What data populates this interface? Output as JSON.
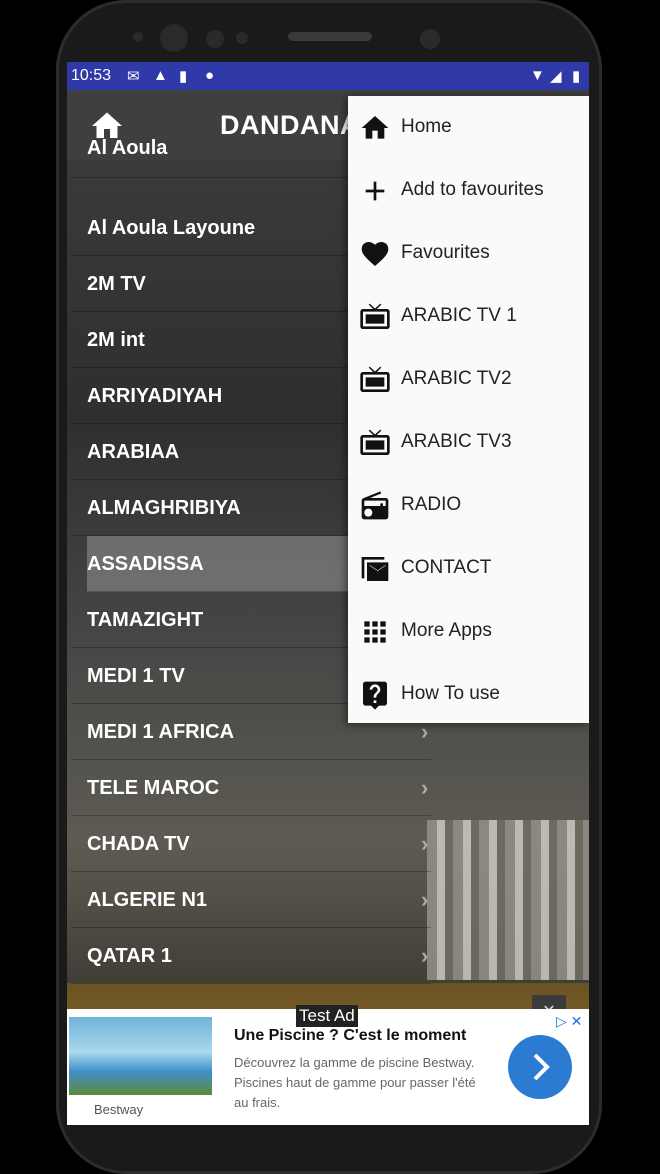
{
  "status_bar": {
    "time": "10:53",
    "icons": [
      "gmail-icon",
      "warning-icon",
      "sd-card-icon",
      "circle-app-icon",
      "wifi-icon",
      "signal-icon",
      "battery-icon"
    ]
  },
  "app_bar": {
    "title": "DANDANA",
    "home_icon": "home-icon"
  },
  "channels": [
    {
      "label": "Al Aoula"
    },
    {
      "label": "Al Aoula Layoune"
    },
    {
      "label": "2M TV"
    },
    {
      "label": "2M int"
    },
    {
      "label": "ARRIYADIYAH"
    },
    {
      "label": "ARABIAA"
    },
    {
      "label": "ALMAGHRIBIYA"
    },
    {
      "label": "ASSADISSA"
    },
    {
      "label": "TAMAZIGHT"
    },
    {
      "label": "MEDI 1 TV"
    },
    {
      "label": "MEDI 1 AFRICA"
    },
    {
      "label": "TELE MAROC"
    },
    {
      "label": "CHADA TV"
    },
    {
      "label": "ALGERIE N1"
    },
    {
      "label": "QATAR 1"
    }
  ],
  "menu": {
    "items": [
      {
        "label": "Home",
        "icon": "home-icon"
      },
      {
        "label": "Add to favourites",
        "icon": "plus-icon"
      },
      {
        "label": "Favourites",
        "icon": "heart-icon"
      },
      {
        "label": "ARABIC TV 1",
        "icon": "tv-icon"
      },
      {
        "label": "ARABIC TV2",
        "icon": "tv-icon"
      },
      {
        "label": "ARABIC TV3",
        "icon": "tv-icon"
      },
      {
        "label": "RADIO",
        "icon": "radio-icon"
      },
      {
        "label": "CONTACT",
        "icon": "mail-icon"
      },
      {
        "label": "More Apps",
        "icon": "grid-icon"
      },
      {
        "label": "How To use",
        "icon": "help-icon"
      }
    ]
  },
  "ad": {
    "badge": "Test Ad",
    "title": "Une Piscine ? C'est le moment",
    "description": "Découvrez la gamme de piscine Bestway. Piscines haut de gamme pour passer l'été au frais.",
    "brand": "Bestway",
    "accent": "#2b7bd3"
  },
  "colors": {
    "status_bar": "#2f3aa8",
    "app_bar": "#3f3f3f",
    "menu_bg": "#fafafa"
  }
}
